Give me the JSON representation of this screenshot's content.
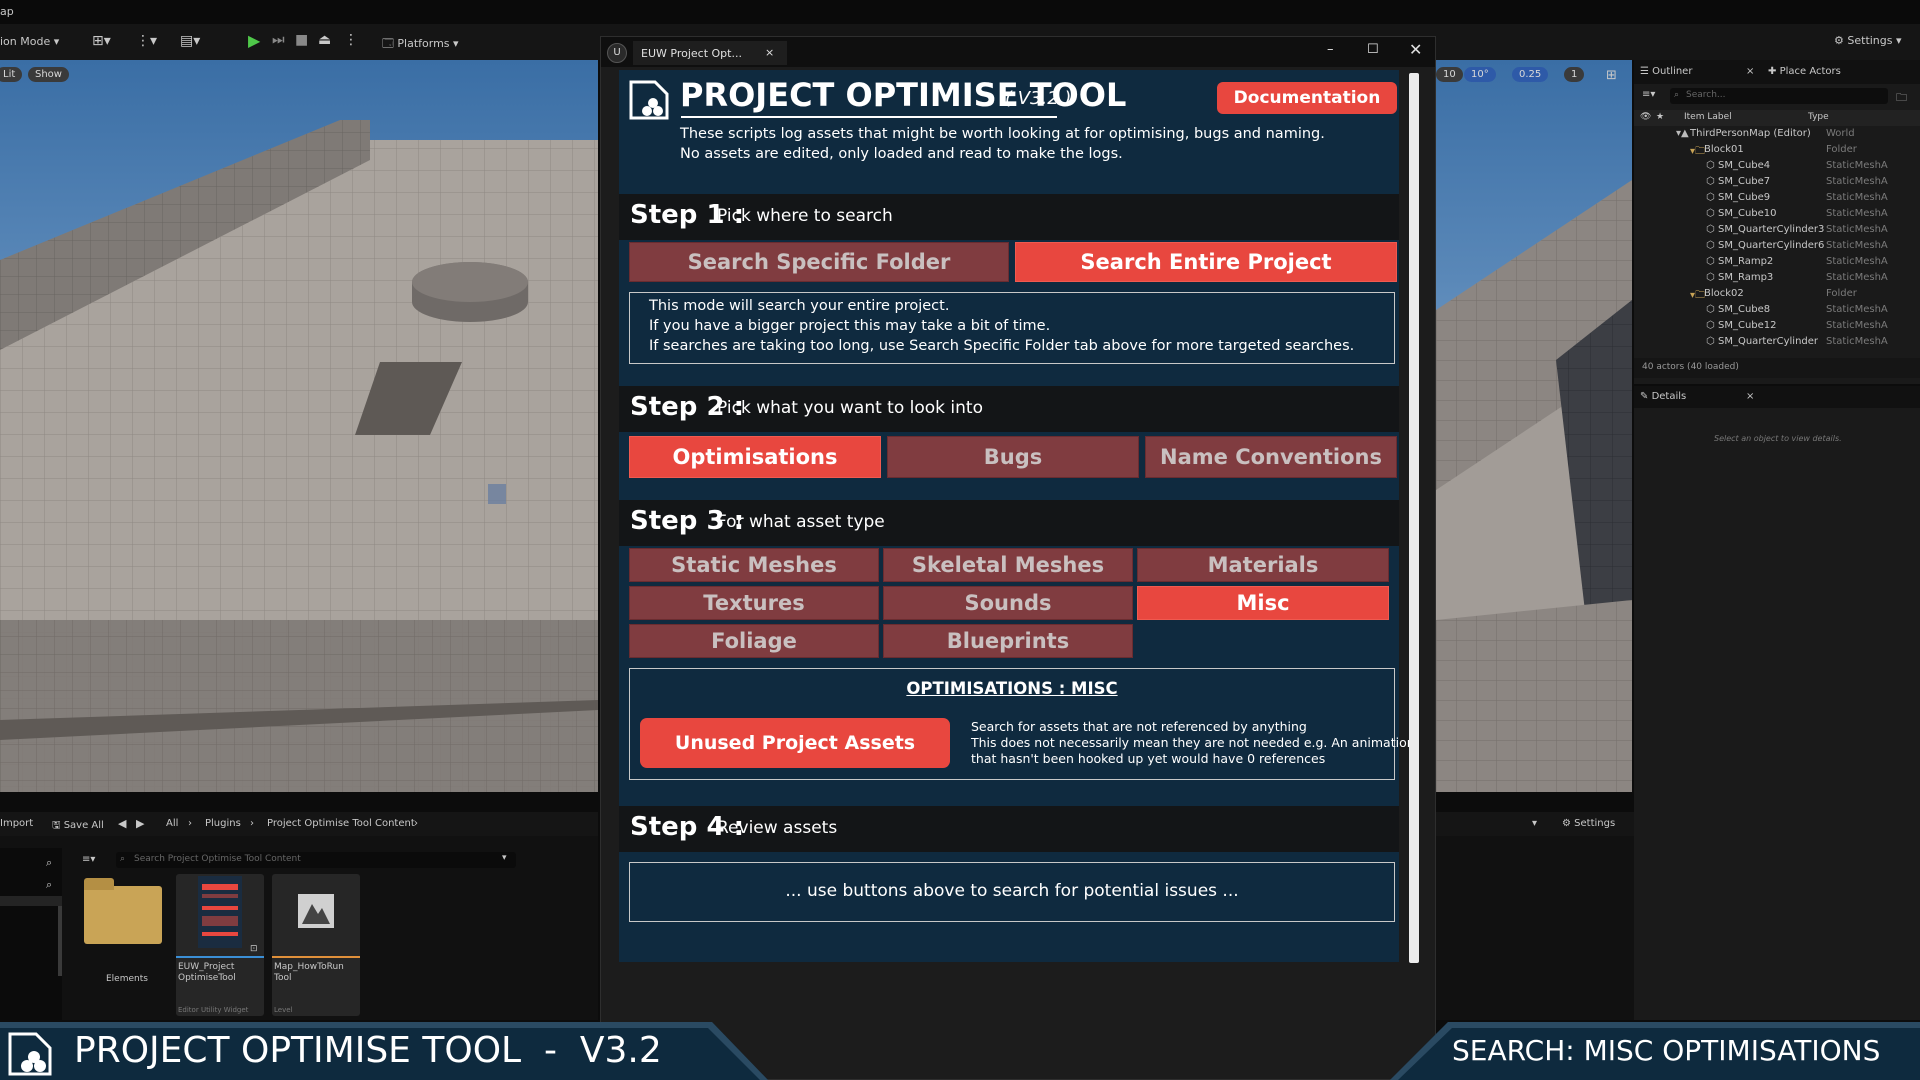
{
  "editor": {
    "top_left_text": "ap",
    "mode_label": "ion Mode",
    "platforms_label": "Platforms",
    "settings_label": "Settings",
    "vp_left_pills": [
      "Lit",
      "Show"
    ],
    "vp_right_pills": [
      "10",
      "10°",
      "0.25",
      "1"
    ],
    "outliner_tab": "Outliner",
    "place_actors_tab": "Place Actors",
    "search_placeholder": "Search...",
    "col_item_label": "Item Label",
    "col_type": "Type",
    "outliner_rows": [
      {
        "label": "ThirdPersonMap (Editor)",
        "type": "World",
        "indent": 0
      },
      {
        "label": "Block01",
        "type": "Folder",
        "indent": 1
      },
      {
        "label": "SM_Cube4",
        "type": "StaticMeshA",
        "indent": 2
      },
      {
        "label": "SM_Cube7",
        "type": "StaticMeshA",
        "indent": 2
      },
      {
        "label": "SM_Cube9",
        "type": "StaticMeshA",
        "indent": 2
      },
      {
        "label": "SM_Cube10",
        "type": "StaticMeshA",
        "indent": 2
      },
      {
        "label": "SM_QuarterCylinder3",
        "type": "StaticMeshA",
        "indent": 2
      },
      {
        "label": "SM_QuarterCylinder6",
        "type": "StaticMeshA",
        "indent": 2
      },
      {
        "label": "SM_Ramp2",
        "type": "StaticMeshA",
        "indent": 2
      },
      {
        "label": "SM_Ramp3",
        "type": "StaticMeshA",
        "indent": 2
      },
      {
        "label": "Block02",
        "type": "Folder",
        "indent": 1
      },
      {
        "label": "SM_Cube8",
        "type": "StaticMeshA",
        "indent": 2
      },
      {
        "label": "SM_Cube12",
        "type": "StaticMeshA",
        "indent": 2
      },
      {
        "label": "SM_QuarterCylinder",
        "type": "StaticMeshA",
        "indent": 2
      }
    ],
    "actors_count": "40 actors (40 loaded)",
    "details_tab": "Details",
    "details_hint": "Select an object to view details.",
    "cb_import": "Import",
    "cb_save_all": "Save All",
    "cb_breadcrumb": [
      "All",
      "Plugins",
      "Project Optimise Tool Content"
    ],
    "cb_search_placeholder": "Search Project Optimise Tool Content",
    "cb_settings": "Settings",
    "assets": [
      {
        "name": "Elements",
        "sub": ""
      },
      {
        "name": "EUW_Project OptimiseTool",
        "sub": "Editor Utility Widget"
      },
      {
        "name": "Map_HowToRun Tool",
        "sub": "Level"
      }
    ]
  },
  "window": {
    "tab_label": "EUW Project Opt...",
    "title": "PROJECT OPTIMISE TOOL",
    "version": "( V3.2 )",
    "documentation_button": "Documentation",
    "intro_line1": "These scripts log assets that might be worth looking at for optimising, bugs and naming.",
    "intro_line2": "No assets are edited, only loaded and read to make the logs.",
    "step1": {
      "num": "Step 1 :",
      "desc": "Pick where to search",
      "btn_folder": "Search Specific Folder",
      "btn_project": "Search Entire Project",
      "info_line1": "This mode will search your entire project.",
      "info_line2": "If you have a bigger project this may take a bit of time.",
      "info_line3": "If searches are taking too long, use Search Specific Folder tab above for more targeted searches."
    },
    "step2": {
      "num": "Step 2 :",
      "desc": "Pick what you want to look into",
      "btn_optimisations": "Optimisations",
      "btn_bugs": "Bugs",
      "btn_names": "Name Conventions"
    },
    "step3": {
      "num": "Step 3 :",
      "desc": "For what asset type",
      "types": [
        "Static Meshes",
        "Skeletal Meshes",
        "Materials",
        "Textures",
        "Sounds",
        "Misc",
        "Foliage",
        "Blueprints"
      ],
      "active_type": "Misc",
      "section_title": "OPTIMISATIONS : MISC",
      "action_button": "Unused Project Assets",
      "action_desc1": "Search for assets that are not referenced by anything",
      "action_desc2": "This does not necessarily mean they are not needed e.g. An animation",
      "action_desc3": "that hasn't been hooked up yet would have 0 references"
    },
    "step4": {
      "num": "Step 4 :",
      "desc": "Review assets",
      "placeholder": "... use buttons above to search for potential issues ..."
    }
  },
  "footer": {
    "left_title": "PROJECT OPTIMISE TOOL  -  V3.2",
    "right_title": "SEARCH: MISC OPTIMISATIONS"
  },
  "colors": {
    "active_button": "#e8473f",
    "inactive_button": "#803c40",
    "panel_bg": "#0f2a3f",
    "footer_bg": "#0e2a3e"
  }
}
